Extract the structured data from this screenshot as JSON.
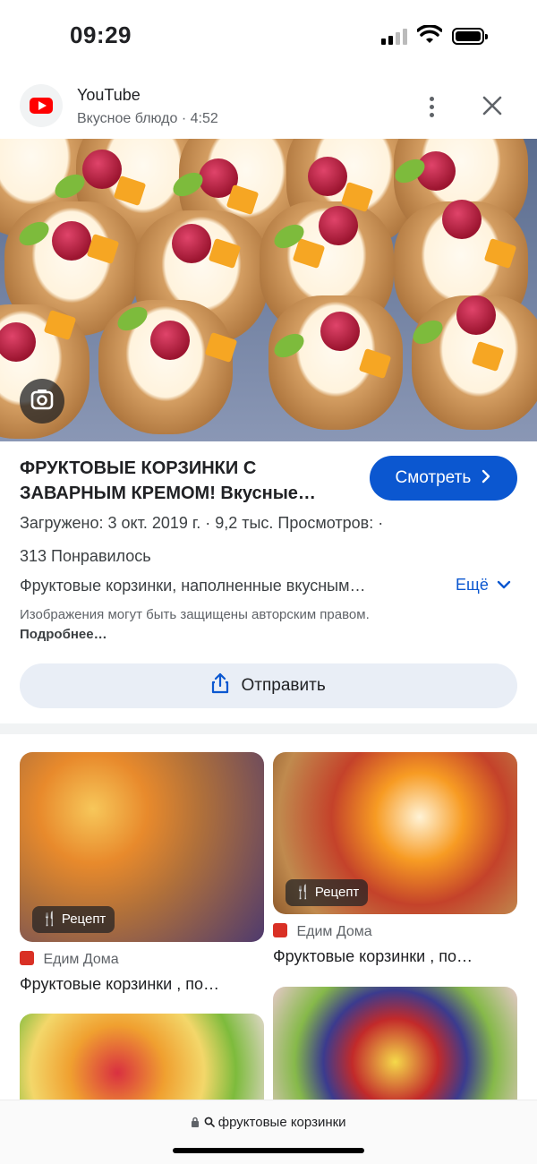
{
  "status_bar": {
    "time": "09:29"
  },
  "source": {
    "name": "YouTube",
    "meta": "Вкусное блюдо · 4:52",
    "icons": [
      "youtube-logo-icon",
      "more-vert-icon",
      "close-icon"
    ]
  },
  "result": {
    "title_line1": "ФРУКТОВЫЕ КОРЗИНКИ С",
    "title_line2": "ЗАВАРНЫМ КРЕМОМ! Вкусные…",
    "watch_label": "Смотреть",
    "meta": "Загружено: 3 окт. 2019 г.  ·  9,2 тыс. Просмотров:  ·",
    "likes": "313 Понравилось",
    "description": "Фруктовые корзинки, наполненные вкусным…",
    "more_label": "Ещё",
    "copyright_text": "Изображения могут быть защищены авторским правом.",
    "copyright_link": "Подробнее…",
    "share_label": "Отправить"
  },
  "grid": {
    "badge_label": "Рецепт",
    "items": [
      {
        "site": "Едим Дома",
        "title": "Фруктовые корзинки , по…"
      },
      {
        "site": "Едим Дома",
        "title": "Фруктовые корзинки , по…"
      }
    ]
  },
  "url_bar": {
    "text": "фруктовые корзинки"
  },
  "colors": {
    "accent": "#0b57d0",
    "share_bg": "#e9eef6",
    "youtube_red": "#ff0000"
  }
}
